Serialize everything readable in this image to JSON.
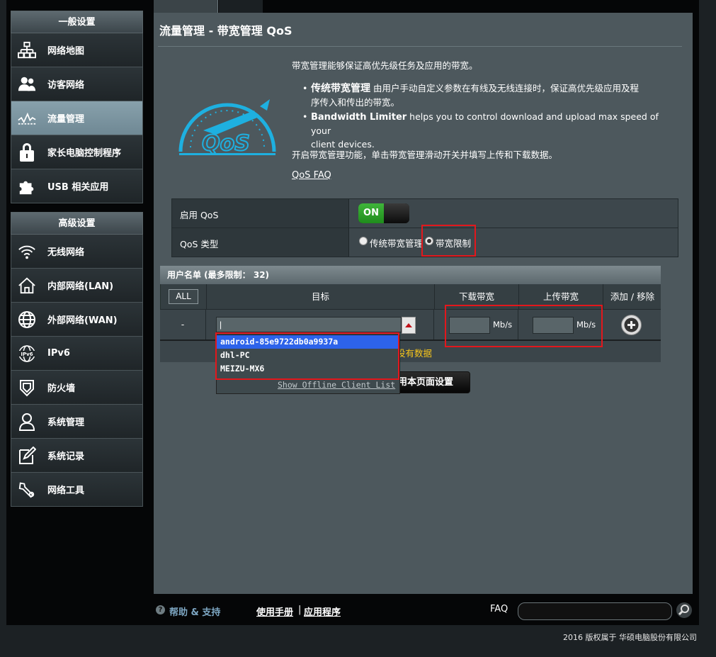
{
  "sidebar": {
    "general_header": "一般设置",
    "general_items": [
      {
        "label": "网络地图",
        "icon": "network-map-icon"
      },
      {
        "label": "访客网络",
        "icon": "guest-network-icon"
      },
      {
        "label": "流量管理",
        "icon": "traffic-manager-icon",
        "active": true
      },
      {
        "label": "家长电脑控制程序",
        "icon": "parental-control-icon"
      },
      {
        "label": "USB 相关应用",
        "icon": "usb-application-icon"
      }
    ],
    "advanced_header": "高级设置",
    "advanced_items": [
      {
        "label": "无线网络",
        "icon": "wireless-icon"
      },
      {
        "label": "内部网络(LAN)",
        "icon": "lan-icon"
      },
      {
        "label": "外部网络(WAN)",
        "icon": "wan-icon"
      },
      {
        "label": "IPv6",
        "icon": "ipv6-icon"
      },
      {
        "label": "防火墙",
        "icon": "firewall-icon"
      },
      {
        "label": "系统管理",
        "icon": "administration-icon"
      },
      {
        "label": "系统记录",
        "icon": "system-log-icon"
      },
      {
        "label": "网络工具",
        "icon": "network-tools-icon"
      }
    ]
  },
  "page": {
    "title": "流量管理 - 带宽管理 QoS",
    "intro": "带宽管理能够保证高优先级任务及应用的带宽。",
    "bullet1_title": "传统带宽管理",
    "bullet1_line1": " 由用户手动自定义参数在有线及无线连接时，保证高优先级应用及程",
    "bullet1_line2": "序传入和传出的带宽。",
    "bullet2_title": "Bandwidth Limiter",
    "bullet2_line1": " helps you to control download and upload max speed of your",
    "bullet2_line2": "client devices.",
    "instruction": "开启带宽管理功能，单击带宽管理滑动开关并填写上传和下载数据。",
    "faq_link": "QoS FAQ"
  },
  "settings": {
    "enable_label": "启用 QoS",
    "toggle_on": "ON",
    "type_label": "QoS 类型",
    "type_options": [
      {
        "label": "传统带宽管理",
        "checked": false
      },
      {
        "label": "带宽限制",
        "checked": true
      }
    ]
  },
  "client_list": {
    "header": "用户名单 (最多限制： 32)",
    "all_button": "ALL",
    "col_target": "目标",
    "col_download": "下载带宽",
    "col_upload": "上传带宽",
    "col_add_remove": "添加 / 移除",
    "row_dash": "-",
    "target_value": "|",
    "unit_down": "Mb/s",
    "unit_up": "Mb/s",
    "no_data": "没有数据"
  },
  "dropdown": {
    "items": [
      "android-85e9722db0a9937a",
      "dhl-PC",
      "MEIZU-MX6"
    ],
    "selected_index": 0,
    "offline_link": "Show Offline Client List"
  },
  "apply_button": "用本页面设置",
  "footer": {
    "help": "帮助 & 支持",
    "manual": "使用手册",
    "separator": "|",
    "app": "应用程序",
    "faq": "FAQ"
  },
  "copyright": "2016 版权属于 华硕电脑股份有限公司",
  "colors": {
    "active_nav": "#7b95a1",
    "toggle_on": "#2fa32b",
    "highlight_box": "#e3171c",
    "dropdown_selected": "#2d63ea",
    "no_data_text": "#f6c51b"
  }
}
